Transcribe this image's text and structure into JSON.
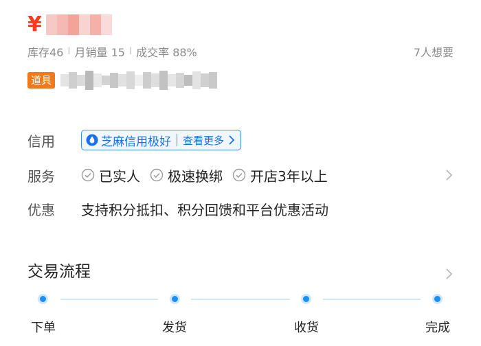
{
  "price": {
    "symbol": "¥"
  },
  "stats": {
    "stock": "库存46",
    "monthly_sales": "月销量 15",
    "conversion": "成交率 88%",
    "wants": "7人想要"
  },
  "tag": {
    "label": "道具"
  },
  "credit": {
    "label": "信用",
    "badge_text": "芝麻信用极好",
    "more_label": "查看更多"
  },
  "service": {
    "label": "服务",
    "items": [
      "已实人",
      "极速换绑",
      "开店3年以上"
    ]
  },
  "promo": {
    "label": "优惠",
    "text": "支持积分抵扣、积分回馈和平台优惠活动"
  },
  "process": {
    "title": "交易流程",
    "steps": [
      "下单",
      "发货",
      "收货",
      "完成"
    ]
  },
  "colors": {
    "price": "#ff3a1f",
    "tag": "#f0791b",
    "accent_blue": "#1a8ff5",
    "badge_blue": "#1a6ff0"
  }
}
